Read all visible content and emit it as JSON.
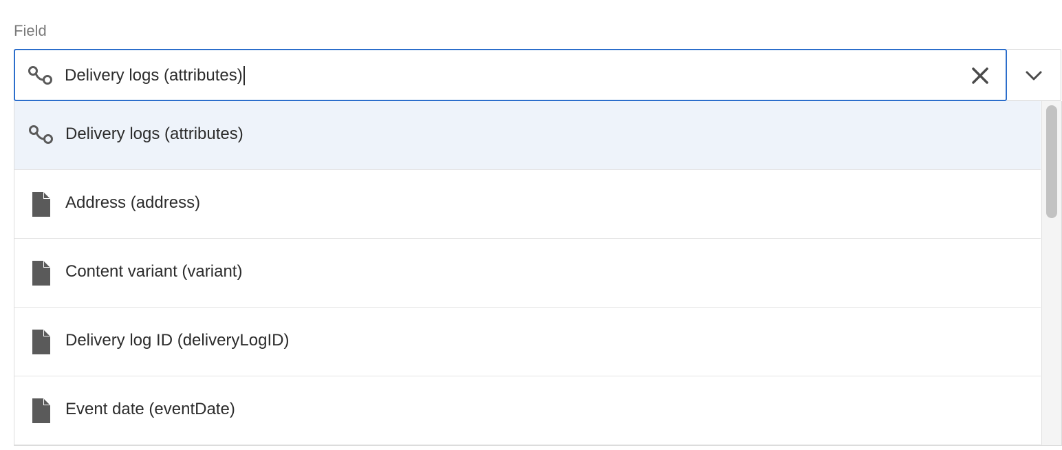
{
  "field": {
    "label": "Field"
  },
  "combo": {
    "value": "Delivery logs (attributes)",
    "value_icon": "link-icon",
    "clear_icon": "close-icon",
    "dropdown_icon": "chevron-down-icon"
  },
  "listbox": {
    "options": [
      {
        "label": "Delivery logs (attributes)",
        "icon": "link-icon",
        "selected": true
      },
      {
        "label": "Address (address)",
        "icon": "file-icon",
        "selected": false
      },
      {
        "label": "Content variant (variant)",
        "icon": "file-icon",
        "selected": false
      },
      {
        "label": "Delivery log ID (deliveryLogID)",
        "icon": "file-icon",
        "selected": false
      },
      {
        "label": "Event date (eventDate)",
        "icon": "file-icon",
        "selected": false
      }
    ]
  },
  "colors": {
    "focus_border": "#2c6ecb",
    "selected_row": "#eef3fa",
    "icon": "#5a5a5a",
    "label": "#7a7a7a"
  }
}
